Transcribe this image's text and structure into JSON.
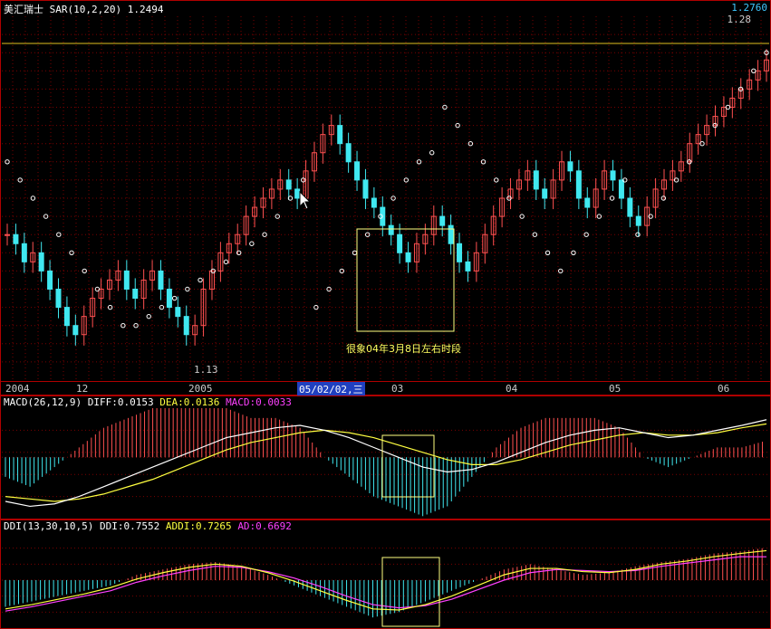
{
  "colors": {
    "background": "#000000",
    "grid": "#7a0000",
    "frame": "#b00000",
    "up_candle": "#ff5050",
    "down_candle": "#40e8f0",
    "sar_dot": "#ffffff",
    "yellow": "#ffff40",
    "diff_line": "#ffffff",
    "magenta": "#ff40ff",
    "cyan_text": "#40c8ff",
    "highlight_box": "#ffff80"
  },
  "price_header": {
    "symbol": "美汇瑞士",
    "indicator": "SAR(10,2,20)",
    "value": "1.2494",
    "top_right_price": "1.2760",
    "resistance_label": "1.28",
    "low_label": "1.13",
    "annotation": "很象04年3月8日左右时段"
  },
  "date_axis": {
    "labels": [
      "2004",
      "12",
      "2005",
      "05/02/02,三",
      "03",
      "04",
      "05",
      "06"
    ]
  },
  "macd_header": {
    "name": "MACD(26,12,9)",
    "diff": "DIFF:0.0153",
    "dea": "DEA:0.0136",
    "macd": "MACD:0.0033"
  },
  "ddi_header": {
    "name": "DDI(13,30,10,5)",
    "ddi": "DDI:0.7552",
    "addi": "ADDI:0.7265",
    "ad": "AD:0.6692"
  },
  "chart_data": [
    {
      "type": "candlestick",
      "title": "美汇瑞士 SAR(10,2,20)",
      "ylim": [
        1.1,
        1.3
      ],
      "series": [
        {
          "name": "close",
          "values": [
            1.18,
            1.175,
            1.165,
            1.17,
            1.16,
            1.15,
            1.14,
            1.13,
            1.125,
            1.135,
            1.145,
            1.15,
            1.155,
            1.16,
            1.15,
            1.145,
            1.155,
            1.16,
            1.15,
            1.14,
            1.135,
            1.125,
            1.13,
            1.15,
            1.16,
            1.17,
            1.175,
            1.18,
            1.19,
            1.195,
            1.2,
            1.205,
            1.21,
            1.205,
            1.2,
            1.215,
            1.225,
            1.235,
            1.24,
            1.23,
            1.22,
            1.21,
            1.2,
            1.195,
            1.185,
            1.18,
            1.17,
            1.165,
            1.175,
            1.18,
            1.19,
            1.185,
            1.175,
            1.165,
            1.16,
            1.17,
            1.18,
            1.19,
            1.2,
            1.205,
            1.21,
            1.215,
            1.205,
            1.2,
            1.21,
            1.22,
            1.215,
            1.2,
            1.195,
            1.205,
            1.215,
            1.21,
            1.2,
            1.19,
            1.185,
            1.195,
            1.205,
            1.21,
            1.215,
            1.22,
            1.23,
            1.235,
            1.24,
            1.245,
            1.25,
            1.255,
            1.26,
            1.265,
            1.27,
            1.276
          ]
        },
        {
          "name": "SAR",
          "values": [
            1.22,
            1.21,
            1.2,
            1.19,
            1.18,
            1.17,
            1.16,
            1.15,
            1.14,
            1.13,
            1.13,
            1.135,
            1.14,
            1.145,
            1.15,
            1.155,
            1.16,
            1.165,
            1.17,
            1.175,
            1.18,
            1.19,
            1.2,
            1.21,
            1.14,
            1.15,
            1.16,
            1.17,
            1.18,
            1.19,
            1.2,
            1.21,
            1.22,
            1.225,
            1.25,
            1.24,
            1.23,
            1.22,
            1.21,
            1.2,
            1.19,
            1.18,
            1.17,
            1.16,
            1.17,
            1.18,
            1.19,
            1.2,
            1.21,
            1.18,
            1.19,
            1.2,
            1.21,
            1.22,
            1.23,
            1.24,
            1.25,
            1.26,
            1.27,
            1.28
          ]
        }
      ]
    },
    {
      "type": "line",
      "title": "MACD(26,12,9)",
      "series": [
        {
          "name": "DIFF",
          "values": [
            -0.018,
            -0.02,
            -0.019,
            -0.016,
            -0.012,
            -0.008,
            -0.004,
            0.0,
            0.004,
            0.008,
            0.01,
            0.012,
            0.013,
            0.011,
            0.008,
            0.004,
            0.0,
            -0.004,
            -0.006,
            -0.005,
            -0.002,
            0.002,
            0.006,
            0.009,
            0.011,
            0.012,
            0.01,
            0.008,
            0.009,
            0.011,
            0.013,
            0.0153
          ]
        },
        {
          "name": "DEA",
          "values": [
            -0.016,
            -0.017,
            -0.018,
            -0.017,
            -0.015,
            -0.012,
            -0.009,
            -0.005,
            -0.001,
            0.003,
            0.006,
            0.008,
            0.01,
            0.011,
            0.01,
            0.008,
            0.005,
            0.002,
            -0.001,
            -0.003,
            -0.003,
            -0.001,
            0.002,
            0.005,
            0.007,
            0.009,
            0.01,
            0.009,
            0.009,
            0.01,
            0.012,
            0.0136
          ]
        }
      ]
    },
    {
      "type": "line",
      "title": "DDI(13,30,10,5)",
      "series": [
        {
          "name": "DDI",
          "values": [
            0.2,
            0.25,
            0.3,
            0.35,
            0.4,
            0.5,
            0.55,
            0.6,
            0.62,
            0.58,
            0.5,
            0.4,
            0.3,
            0.2,
            0.1,
            0.15,
            0.25,
            0.35,
            0.45,
            0.55,
            0.6,
            0.55,
            0.5,
            0.52,
            0.58,
            0.62,
            0.65,
            0.7,
            0.72,
            0.7552
          ]
        },
        {
          "name": "ADDI",
          "values": [
            0.18,
            0.22,
            0.27,
            0.32,
            0.38,
            0.46,
            0.52,
            0.57,
            0.6,
            0.58,
            0.52,
            0.44,
            0.35,
            0.26,
            0.18,
            0.17,
            0.22,
            0.3,
            0.4,
            0.5,
            0.56,
            0.56,
            0.53,
            0.52,
            0.55,
            0.6,
            0.63,
            0.67,
            0.7,
            0.7265
          ]
        },
        {
          "name": "AD",
          "values": [
            0.16,
            0.2,
            0.25,
            0.3,
            0.35,
            0.43,
            0.49,
            0.54,
            0.58,
            0.57,
            0.53,
            0.47,
            0.39,
            0.3,
            0.22,
            0.19,
            0.21,
            0.27,
            0.36,
            0.45,
            0.52,
            0.55,
            0.54,
            0.53,
            0.54,
            0.58,
            0.61,
            0.64,
            0.67,
            0.6692
          ]
        }
      ]
    }
  ]
}
